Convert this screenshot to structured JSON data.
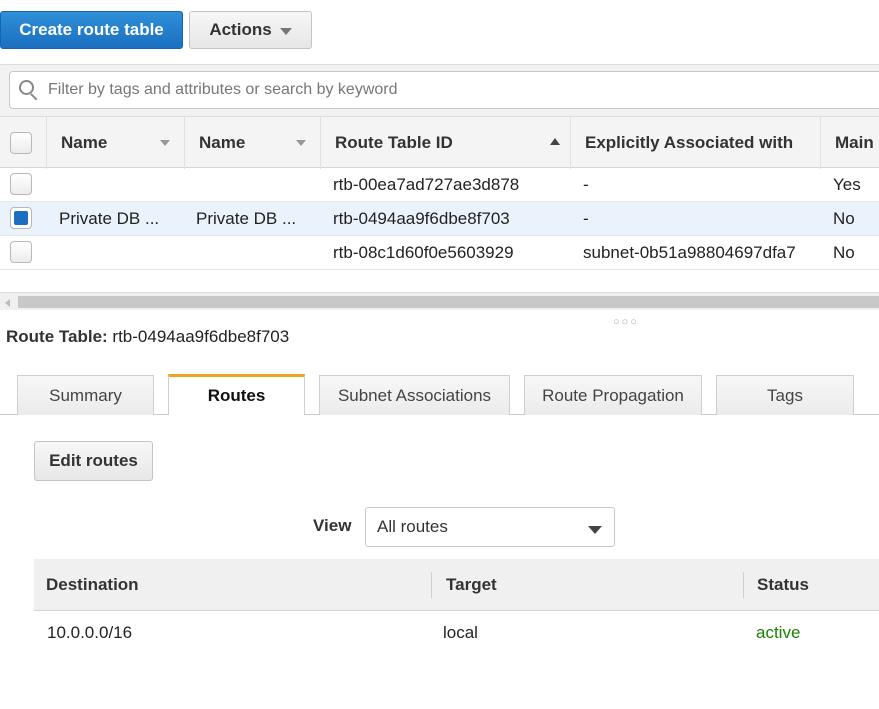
{
  "toolbar": {
    "create_label": "Create route table",
    "actions_label": "Actions"
  },
  "filter": {
    "placeholder": "Filter by tags and attributes or search by keyword"
  },
  "table": {
    "columns": [
      "Name",
      "Name",
      "Route Table ID",
      "Explicitly Associated with",
      "Main"
    ],
    "rows": [
      {
        "name1": "",
        "name2": "",
        "id": "rtb-00ea7ad727ae3d878",
        "assoc": "-",
        "main": "Yes",
        "selected": false
      },
      {
        "name1": "Private  DB ...",
        "name2": "Private  DB ...",
        "id": "rtb-0494aa9f6dbe8f703",
        "assoc": "-",
        "main": "No",
        "selected": true
      },
      {
        "name1": "",
        "name2": "",
        "id": "rtb-08c1d60f0e5603929",
        "assoc": "subnet-0b51a98804697dfa7",
        "main": "No",
        "selected": false
      }
    ]
  },
  "detail": {
    "label": "Route Table:",
    "id": "rtb-0494aa9f6dbe8f703",
    "tabs": [
      "Summary",
      "Routes",
      "Subnet Associations",
      "Route Propagation",
      "Tags"
    ],
    "active_tab": "Routes",
    "edit_label": "Edit routes",
    "view_label": "View",
    "view_value": "All routes",
    "routes": {
      "columns": [
        "Destination",
        "Target",
        "Status"
      ],
      "rows": [
        {
          "destination": "10.0.0.0/16",
          "target": "local",
          "status": "active"
        }
      ]
    }
  },
  "colors": {
    "primary": "#1a6fc0",
    "active_tab_accent": "#f0a51d",
    "status_active": "#1d8102"
  }
}
